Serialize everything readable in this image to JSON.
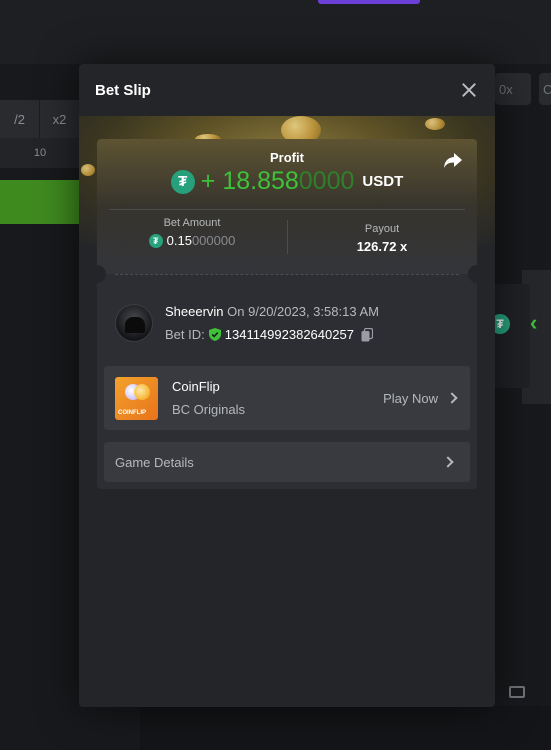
{
  "background": {
    "row_buttons": [
      "/2",
      "x2"
    ],
    "row_value": "10",
    "right_buttons": [
      "0x",
      "C"
    ]
  },
  "modal": {
    "title": "Bet Slip",
    "profit": {
      "label": "Profit",
      "sign": "+",
      "value_main": "18.858",
      "value_dim": "0000",
      "currency": "USDT"
    },
    "bet_amount": {
      "label": "Bet Amount",
      "value_main": "0.15",
      "value_dim": "000000"
    },
    "payout": {
      "label": "Payout",
      "value": "126.72 x"
    },
    "user": {
      "name": "Sheeervin",
      "date_text": "On 9/20/2023, 3:58:13 AM",
      "bet_id_label": "Bet ID:",
      "bet_id": "134114992382640257"
    },
    "game": {
      "thumb_text": "COINFLIP",
      "name": "CoinFlip",
      "category": "BC Originals",
      "play_label": "Play Now"
    },
    "details_label": "Game Details"
  },
  "colors": {
    "accent_green": "#3dc23a",
    "tether": "#26a17b",
    "modal_bg": "#242529",
    "card_bg": "#2d2e33"
  },
  "icons": [
    "close-icon",
    "share-icon",
    "tether-icon",
    "shield-check-icon",
    "copy-icon",
    "chevron-right-icon"
  ]
}
